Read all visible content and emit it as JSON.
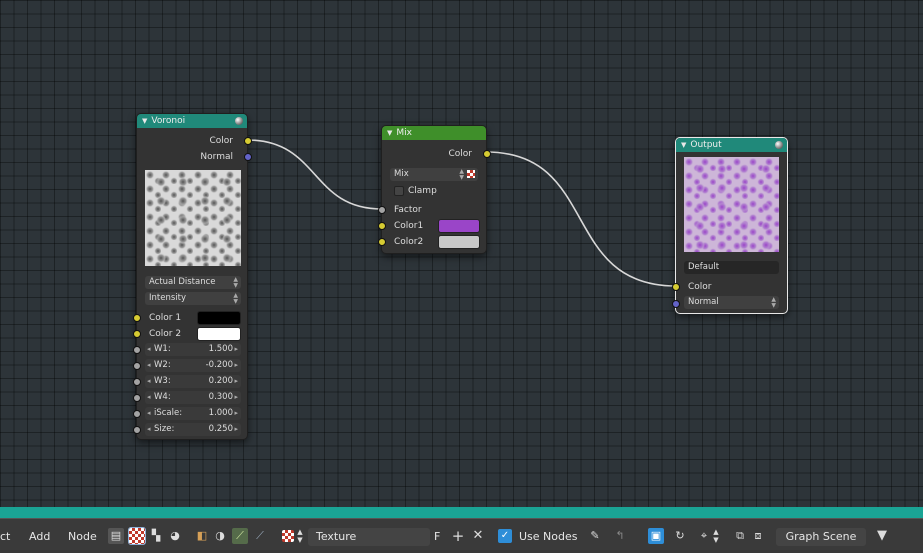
{
  "nodes": {
    "voronoi": {
      "title": "Voronoi",
      "outputs": {
        "color": "Color",
        "normal": "Normal"
      },
      "distance_metric": "Actual Distance",
      "coloring": "Intensity",
      "color1_label": "Color 1",
      "color2_label": "Color 2",
      "color1": "#000000",
      "color2": "#ffffff",
      "params": [
        {
          "label": "W1:",
          "value": "1.500"
        },
        {
          "label": "W2:",
          "value": "-0.200"
        },
        {
          "label": "W3:",
          "value": "0.200"
        },
        {
          "label": "W4:",
          "value": "0.300"
        },
        {
          "label": "iScale:",
          "value": "1.000"
        },
        {
          "label": "Size:",
          "value": "0.250"
        }
      ]
    },
    "mix": {
      "title": "Mix",
      "output": "Color",
      "blend_mode": "Mix",
      "clamp_label": "Clamp",
      "clamp": false,
      "factor_label": "Factor",
      "color1_label": "Color1",
      "color2_label": "Color2",
      "color1": "#9a45c8",
      "color2": "#c8c8c8"
    },
    "output": {
      "title": "Output",
      "preset": "Default",
      "color_label": "Color",
      "normal_label": "Normal"
    }
  },
  "toolbar": {
    "select_label": "ct",
    "add_label": "Add",
    "node_label": "Node",
    "texture_name": "Texture",
    "fake_user": "F",
    "use_nodes_label": "Use Nodes",
    "use_nodes": true,
    "graph_scene": "Graph Scene"
  },
  "colors": {
    "accent_teal": "#1aa495",
    "voronoi_header": "#20897a",
    "mix_header": "#3f8f2a",
    "socket_color": "#d6cb32",
    "socket_float": "#a3a3a3",
    "socket_vector": "#6363c7"
  }
}
